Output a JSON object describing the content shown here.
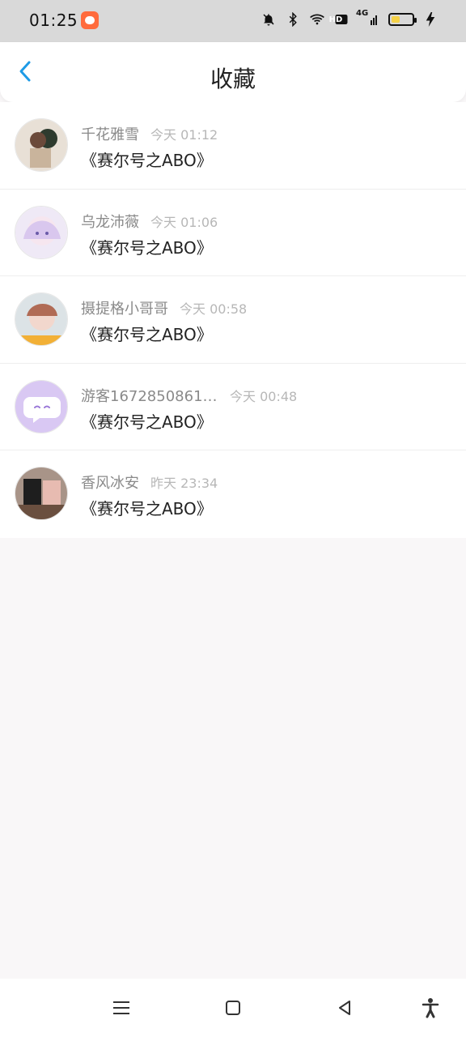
{
  "status": {
    "time": "01:25",
    "network": "HD",
    "signal_label": "4G"
  },
  "header": {
    "title": "收藏"
  },
  "favorites": [
    {
      "username": "千花雅雪",
      "time": "今天 01:12",
      "work": "《赛尔号之ABO》",
      "avatar_icon": "photo-avatar-1",
      "avatar_color": "#b7a48f"
    },
    {
      "username": "乌龙沛薇",
      "time": "今天 01:06",
      "work": "《赛尔号之ABO》",
      "avatar_icon": "anime-avatar-2",
      "avatar_color": "#c5b8d8"
    },
    {
      "username": "摄提格小哥哥",
      "time": "今天 00:58",
      "work": "《赛尔号之ABO》",
      "avatar_icon": "photo-avatar-3",
      "avatar_color": "#9ab0b6"
    },
    {
      "username": "游客16728508616...",
      "time": "今天 00:48",
      "work": "《赛尔号之ABO》",
      "avatar_icon": "default-guest-avatar",
      "avatar_color": "#d8c8f0"
    },
    {
      "username": "香风冰安",
      "time": "昨天 23:34",
      "work": "《赛尔号之ABO》",
      "avatar_icon": "photo-avatar-5",
      "avatar_color": "#6b5a52"
    }
  ]
}
